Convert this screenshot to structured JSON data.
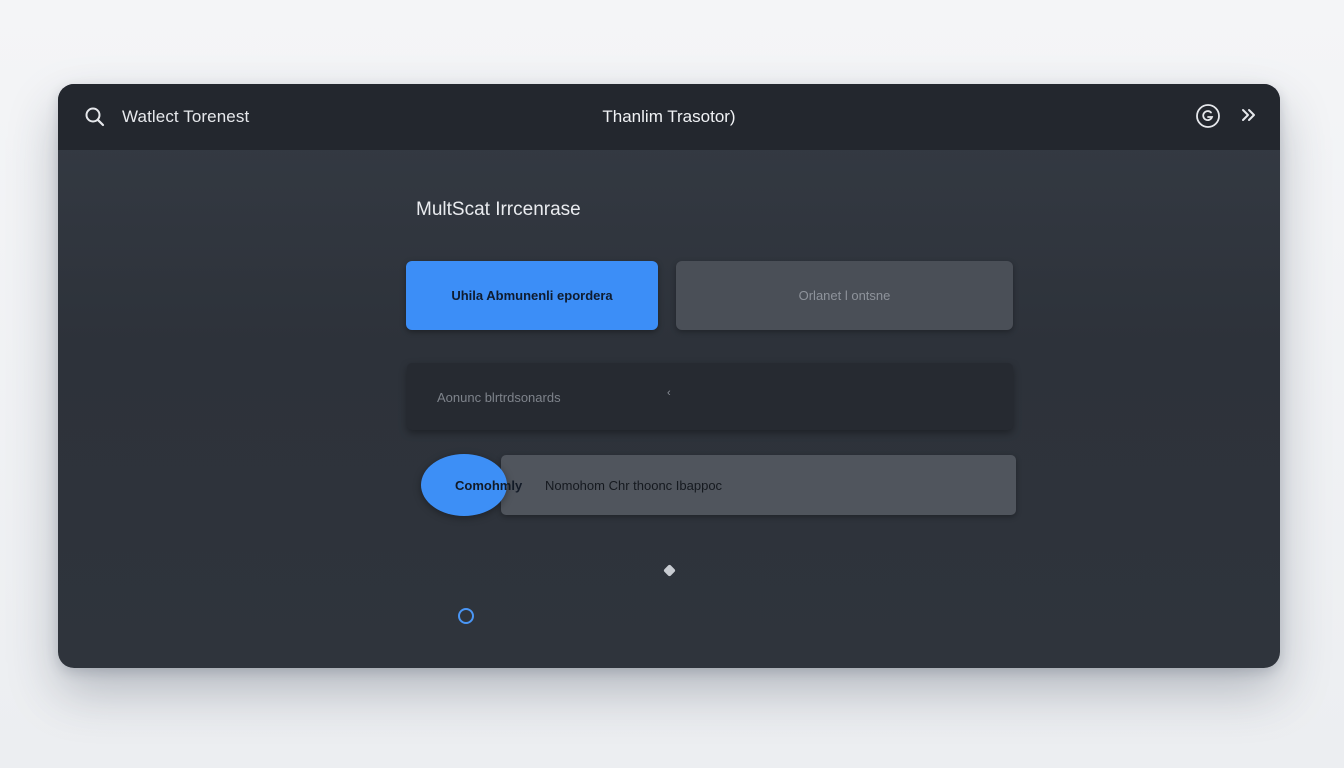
{
  "header": {
    "search_label": "Watlect Torenest",
    "title": "Thanlim Trasotor)"
  },
  "icons": {
    "search": "search-icon",
    "settings": "settings-icon",
    "forward": "chevrons-right-icon"
  },
  "main": {
    "heading": "MultScat Irrcenrase",
    "primary_button": "Uhila Abmunenli eporderа",
    "secondary_button": "Orlanet l ontsne",
    "field_placeholder": "Aonunc  blrtrdsonards",
    "field_caret": "‹",
    "toggle_label": "Comohmly",
    "toggle_description": "Nomohom Chr thoonc Ibappoc"
  },
  "colors": {
    "accent": "#3c8ef7",
    "titlebar": "#23272e",
    "panel": "#2f343c"
  }
}
